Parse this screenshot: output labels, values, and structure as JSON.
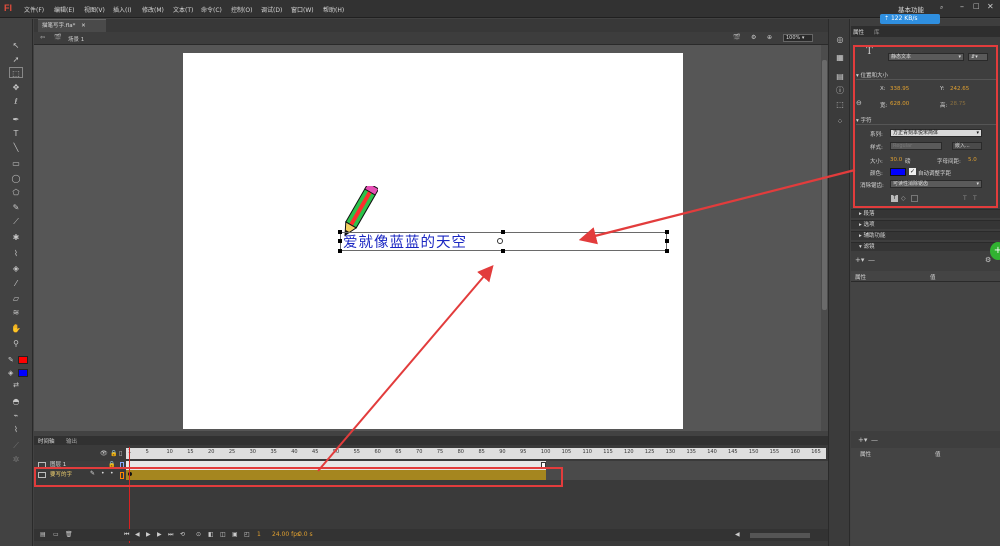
{
  "app": {
    "logo": "Fl"
  },
  "menubar": {
    "items": [
      "文件(F)",
      "编辑(E)",
      "视图(V)",
      "插入(I)",
      "修改(M)",
      "文本(T)",
      "命令(C)",
      "控制(O)",
      "调试(D)",
      "窗口(W)",
      "帮助(H)"
    ],
    "workspace": "基本功能",
    "net_speed": "122 KB/s"
  },
  "document": {
    "tab": "描笔写字.fla*",
    "scene": "场景 1",
    "zoom": "100%"
  },
  "stage": {
    "text": "爱就像蓝蓝的天空"
  },
  "timeline": {
    "title": "时间轴",
    "output_tab": "输出",
    "ruler": [
      "1",
      "5",
      "10",
      "15",
      "20",
      "25",
      "30",
      "35",
      "40",
      "45",
      "50",
      "55",
      "60",
      "65",
      "70",
      "75",
      "80",
      "85",
      "90",
      "95",
      "100",
      "105",
      "110",
      "115",
      "120",
      "125",
      "130",
      "135",
      "140",
      "145",
      "150",
      "155",
      "160",
      "165"
    ],
    "layers": [
      {
        "name": "图层 1"
      },
      {
        "name": "要写的字"
      }
    ],
    "status_frame": "1",
    "status_fps": "24.00 fps",
    "status_time": "0.0 s"
  },
  "properties": {
    "tab_props": "属性",
    "tab_lib": "库",
    "text_type": "静态文本",
    "section_position": "位置和大小",
    "x_label": "X:",
    "x_value": "338.95",
    "y_label": "Y:",
    "y_value": "242.65",
    "w_label": "宽:",
    "w_value": "628.00",
    "h_label": "高:",
    "h_value": "28.75",
    "section_char": "字符",
    "family_label": "系列:",
    "family_value": "方正青刻本悦宋简体",
    "style_label": "样式:",
    "style_value": "Regular",
    "embed_button": "嵌入...",
    "size_label": "大小:",
    "size_value": "30.0",
    "size_unit": "磅",
    "spacing_label": "字母间距:",
    "spacing_value": "5.0",
    "color_label": "颜色:",
    "color_value": "#0000ff",
    "autokern_label": "自动调整字距",
    "aa_label": "消除锯齿:",
    "aa_value": "可读性消除锯齿",
    "sections": [
      "段落",
      "选项",
      "辅助功能",
      "滤镜"
    ],
    "col_prop": "属性",
    "col_val": "值"
  }
}
